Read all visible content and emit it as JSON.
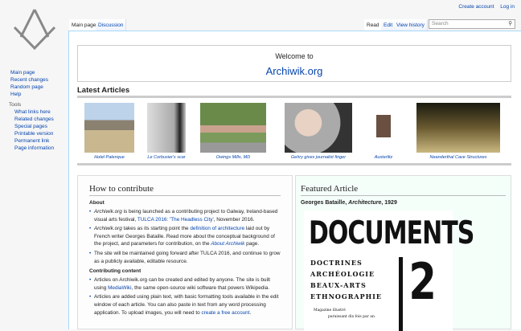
{
  "personal": {
    "create_account": "Create account",
    "log_in": "Log in"
  },
  "tabs": {
    "main_page": "Main page",
    "discussion": "Discussion",
    "read": "Read",
    "edit": "Edit",
    "view_history": "View history"
  },
  "search": {
    "placeholder": "Search"
  },
  "sidebar": {
    "nav": [
      "Main page",
      "Recent changes",
      "Random page",
      "Help"
    ],
    "tools_heading": "Tools",
    "tools": [
      "What links here",
      "Related changes",
      "Special pages",
      "Printable version",
      "Permanent link",
      "Page information"
    ]
  },
  "welcome": {
    "line1": "Welcome to",
    "line2": "Archiwik.org"
  },
  "latest": {
    "heading": "Latest Articles",
    "items": [
      "Hotel Palenque",
      "Le Corbusier's scar",
      "Owings Mills, MD",
      "Gehry gives journalist finger",
      "Austerlitz",
      "Neanderthal Cave Structures"
    ]
  },
  "contribute": {
    "heading": "How to contribute",
    "about": "About",
    "about_items": [
      {
        "pre_em": "Archiwik.org",
        "text": " is being launched as a contributing project to Galway, Ireland-based visual arts festival, ",
        "link": "TULCA 2016: 'The Headless City'",
        "post": ", November 2016."
      },
      {
        "pre_em": "Archiwik.org",
        "text": " takes as its starting point the ",
        "link": "definition of architecture",
        "mid": " laid out by French writer Georges Bataille. Read more about the conceptual background of the project, and parameters for contribution, on the ",
        "link2": "About Archiwik",
        "post": " page."
      },
      {
        "text": "The site will be maintained going forward after TULCA 2016, and continue to grow as a publicly available, editable resource."
      }
    ],
    "contributing": "Contributing content",
    "contributing_items": [
      {
        "text": "Articles on Archiwik.org can be created and edited by anyone. The site is built using ",
        "link": "MediaWiki",
        "post": ", the same open-source wiki software that powers Wikipedia."
      },
      {
        "text": "Articles are added using plain text, with basic formatting tools available in the edit window of each article. You can also paste in text from any word processing application. To upload images, you will need to ",
        "link": "create a free account",
        "post": "."
      }
    ]
  },
  "featured": {
    "heading": "Featured Article",
    "author": "Georges Bataille, ",
    "title": "Architecture",
    "year": ", 1929",
    "image_text": {
      "title": "DOCUMENTS",
      "lines": [
        "DOCTRINES",
        "ARCHÉOLOGIE",
        "BEAUX-ARTS",
        "ETHNOGRAPHIE"
      ],
      "number": "2",
      "small1": "Magazine illustré",
      "small2": "paraissant dix fois par an"
    }
  }
}
